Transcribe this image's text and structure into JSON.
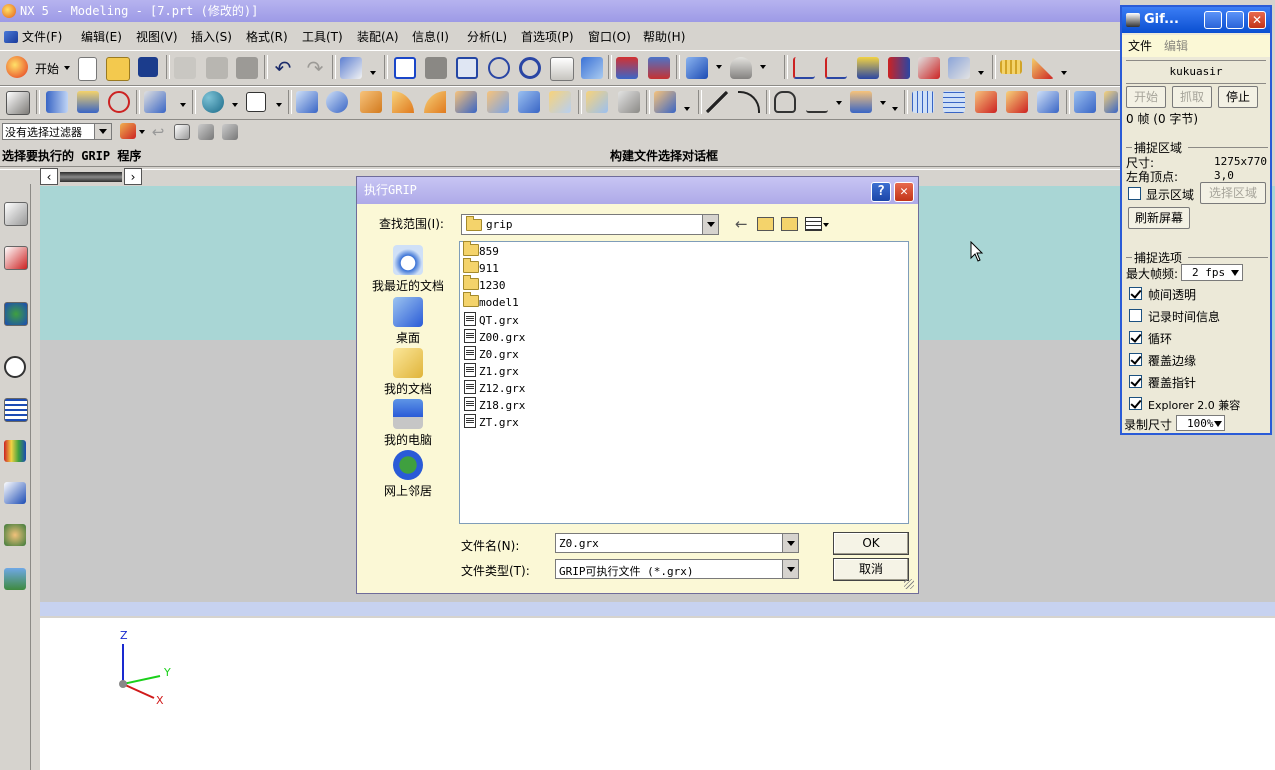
{
  "main_window": {
    "title": "NX 5 - Modeling - [7.prt (修改的)]"
  },
  "menubar": [
    {
      "label": "文件(F)"
    },
    {
      "label": "编辑(E)"
    },
    {
      "label": "视图(V)"
    },
    {
      "label": "插入(S)"
    },
    {
      "label": "格式(R)"
    },
    {
      "label": "工具(T)"
    },
    {
      "label": "装配(A)"
    },
    {
      "label": "信息(I)"
    },
    {
      "label": "分析(L)"
    },
    {
      "label": "首选项(P)"
    },
    {
      "label": "窗口(O)"
    },
    {
      "label": "帮助(H)"
    }
  ],
  "toolbar": {
    "start_label": "开始"
  },
  "selection_filter": {
    "value": "没有选择过滤器"
  },
  "cue_line": {
    "prompt": "选择要执行的 GRIP 程序",
    "status": "构建文件选择对话框"
  },
  "dialog": {
    "title": "执行GRIP",
    "look_in_label": "查找范围(I):",
    "look_in_value": "grip",
    "places": [
      {
        "label": "我最近的文档",
        "icon": "recent-documents-icon"
      },
      {
        "label": "桌面",
        "icon": "desktop-icon"
      },
      {
        "label": "我的文档",
        "icon": "my-documents-icon"
      },
      {
        "label": "我的电脑",
        "icon": "my-computer-icon"
      },
      {
        "label": "网上邻居",
        "icon": "network-places-icon"
      }
    ],
    "files": [
      {
        "name": "859",
        "type": "folder"
      },
      {
        "name": "911",
        "type": "folder"
      },
      {
        "name": "1230",
        "type": "folder"
      },
      {
        "name": "model1",
        "type": "folder"
      },
      {
        "name": "QT.grx",
        "type": "file"
      },
      {
        "name": "Z00.grx",
        "type": "file"
      },
      {
        "name": "Z0.grx",
        "type": "file"
      },
      {
        "name": "Z1.grx",
        "type": "file"
      },
      {
        "name": "Z12.grx",
        "type": "file"
      },
      {
        "name": "Z18.grx",
        "type": "file"
      },
      {
        "name": "ZT.grx",
        "type": "file"
      }
    ],
    "filename_label": "文件名(N):",
    "filename_value": "Z0.grx",
    "filetype_label": "文件类型(T):",
    "filetype_value": "GRIP可执行文件 (*.grx)",
    "ok_label": "OK",
    "cancel_label": "取消"
  },
  "gif_window": {
    "title": "Gif...",
    "menu": [
      "文件",
      "编辑"
    ],
    "username": "kukuasir",
    "buttons": {
      "start": "开始",
      "capture": "抓取",
      "stop": "停止"
    },
    "frames_info": "0 帧 (0 字节)",
    "capture_area_title": "捕捉区域",
    "size_label": "尺寸:",
    "size_value": "1275x770",
    "corner_label": "左角顶点:",
    "corner_value": "3,0",
    "show_area_label": "显示区域",
    "select_area_label": "选择区域",
    "refresh_label": "刷新屏幕",
    "capture_options_title": "捕捉选项",
    "max_fps_label": "最大帧频:",
    "max_fps_value": "2 fps",
    "options": [
      {
        "label": "帧间透明",
        "checked": true
      },
      {
        "label": "记录时间信息",
        "checked": false
      },
      {
        "label": "循环",
        "checked": true
      },
      {
        "label": "覆盖边缘",
        "checked": true
      },
      {
        "label": "覆盖指针",
        "checked": true
      },
      {
        "label": "Explorer 2.0 兼容",
        "checked": true
      }
    ],
    "record_size_label": "录制尺寸",
    "record_size_value": "100%"
  },
  "triad": {
    "z": "Z",
    "y": "Y",
    "x": "X"
  },
  "colors": {
    "dialog_bg": "#fbf8d6",
    "canvas_top": "#a9d6d5",
    "gif_title": "#0a4fd1"
  }
}
